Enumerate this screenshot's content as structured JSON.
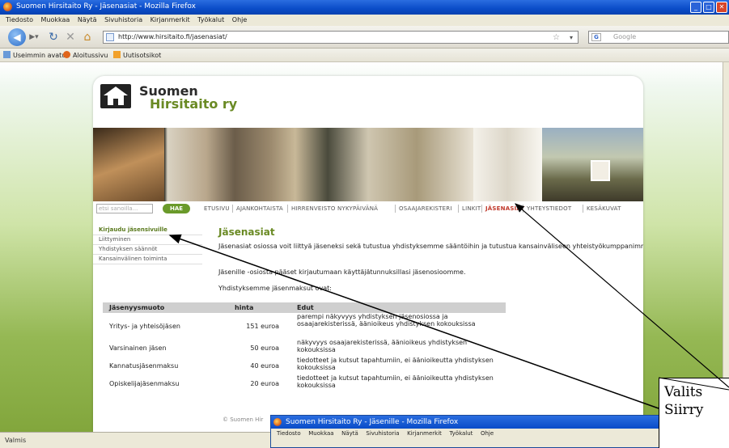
{
  "window": {
    "title": "Suomen Hirsitaito Ry - Jäsenasiat - Mozilla Firefox",
    "min": "_",
    "max": "□",
    "close": "✕"
  },
  "menu": [
    "Tiedosto",
    "Muokkaa",
    "Näytä",
    "Sivuhistoria",
    "Kirjanmerkit",
    "Työkalut",
    "Ohje"
  ],
  "toolbar": {
    "url": "http://www.hirsitaito.fi/jasenasiat/",
    "search_placeholder": "Google",
    "search_engine": "G"
  },
  "bookmarks": [
    "Useimmin avatut",
    "Aloitussivu",
    "Uutisotsikot"
  ],
  "site": {
    "brand_line1": "Suomen",
    "brand_line2": "Hirsitaito ry",
    "search_placeholder": "etsi sanoilla...",
    "search_button": "HAE",
    "nav": [
      "ETUSIVU",
      "AJANKOHTAISTA",
      "HIRRENVEISTO NYKYPÄIVÄNÄ",
      "OSAAJAREKISTERI",
      "LINKIT",
      "JÄSENASIAT",
      "YHTEYSTIEDOT",
      "KESÄKUVAT"
    ],
    "nav_active_index": 5,
    "side_menu": [
      "Kirjaudu jäsensivuille",
      "Liittyminen",
      "Yhdistyksen säännöt",
      "Kansainvälinen toiminta"
    ],
    "heading": "Jäsenasiat",
    "intro": "Jäsenasiat osiossa voit liittyä jäseneksi sekä tutustua yhdistyksemme sääntöihin ja tutustua kansainväliseen yhteistyökumppanimme.",
    "members_note": "Jäsenille -osiosta pääset kirjautumaan käyttäjätunnuksillasi jäsenosioomme.",
    "fees_intro": "Yhdistyksemme jäsenmaksut ovat:",
    "table": {
      "headers": [
        "Jäsenyysmuoto",
        "hinta",
        "Edut"
      ],
      "rows": [
        {
          "type": "Yritys- ja yhteisöjäsen",
          "price": "151 euroa",
          "benefits": "parempi näkyvyys yhdistyksen jäsenosiossa ja osaajarekisterissä, äänioikeus yhdistyksen kokouksissa"
        },
        {
          "type": "Varsinainen jäsen",
          "price": "50 euroa",
          "benefits": "näkyvyys osaajarekisterissä, äänioikeus yhdistyksen kokouksissa"
        },
        {
          "type": "Kannatusjäsenmaksu",
          "price": "40 euroa",
          "benefits": "tiedotteet ja kutsut tapahtumiin, ei äänioikeutta yhdistyksen kokouksissa"
        },
        {
          "type": "Opiskelijajäsenmaksu",
          "price": "20 euroa",
          "benefits": "tiedotteet ja kutsut tapahtumiin, ei äänioikeutta yhdistyksen kokouksissa"
        }
      ]
    },
    "footer": "© Suomen Hir"
  },
  "status": "Valmis",
  "second_window": {
    "title": "Suomen Hirsitaito Ry - Jäsenille - Mozilla Firefox",
    "menu": [
      "Tiedosto",
      "Muokkaa",
      "Näytä",
      "Sivuhistoria",
      "Kirjanmerkit",
      "Työkalut",
      "Ohje"
    ]
  },
  "annotation": {
    "line1": "Valits",
    "line2": "Siirry"
  }
}
